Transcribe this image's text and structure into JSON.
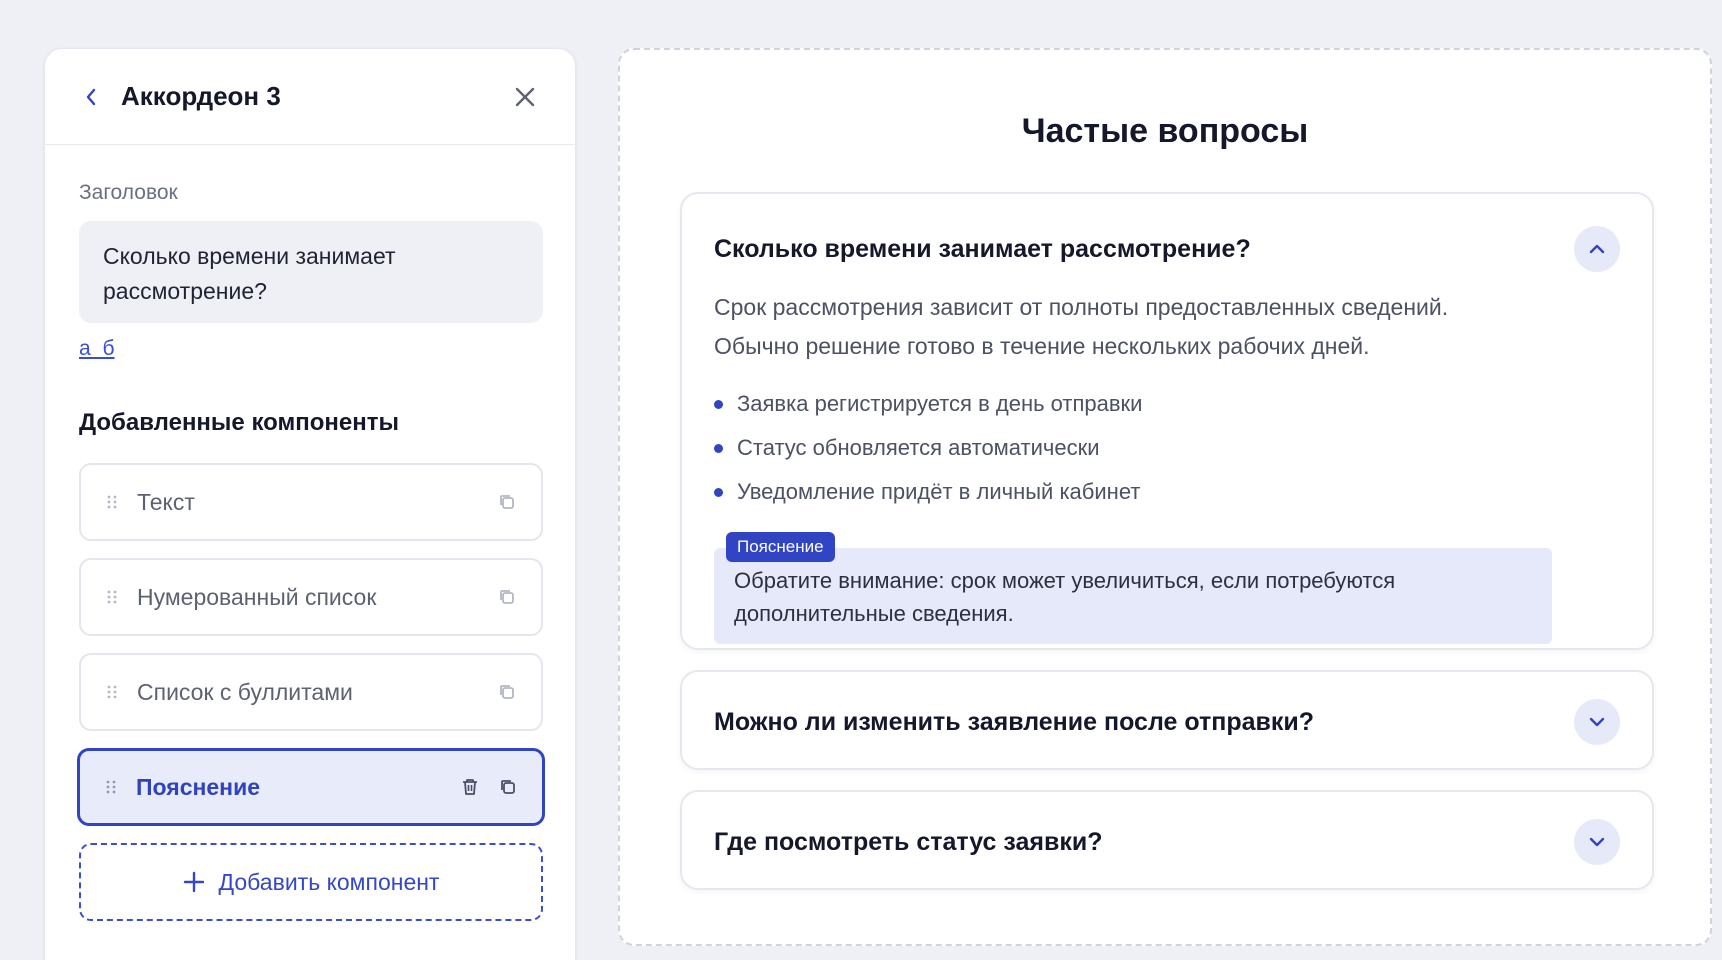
{
  "editor": {
    "title": "Аккордеон 3",
    "heading_label": "Заголовок",
    "heading_value": "Сколько времени занимает рассмотрение?",
    "format_link": "а б",
    "components_heading": "Добавленные компоненты",
    "components": [
      {
        "label": "Текст",
        "active": false
      },
      {
        "label": "Нумерованный список",
        "active": false
      },
      {
        "label": "Список с буллитами",
        "active": false
      },
      {
        "label": "Пояснение",
        "active": true
      }
    ],
    "add_button": "Добавить компонент"
  },
  "preview": {
    "title": "Частые вопросы",
    "items": [
      {
        "question": "Сколько времени занимает рассмотрение?",
        "expanded": true,
        "answer_lines": [
          "Срок рассмотрения зависит от полноты предоставленных сведений.",
          "Обычно решение готово в течение нескольких рабочих дней."
        ],
        "bullets": [
          "Заявка регистрируется в день отправки",
          "Статус обновляется автоматически",
          "Уведомление придёт в личный кабинет"
        ],
        "note_tag": "Пояснение",
        "note_text": "Обратите внимание: срок может увеличиться, если потребуются дополнительные сведения."
      },
      {
        "question": "Можно ли изменить заявление после отправки?",
        "expanded": false
      },
      {
        "question": "Где посмотреть статус заявки?",
        "expanded": false
      }
    ]
  },
  "colors": {
    "accent": "#3144c4",
    "background": "#eef0f5",
    "note_bg": "#e6e9fa",
    "chevron_bg": "#e6e9f7"
  },
  "icons": {
    "back": "chevron-left-icon",
    "close": "close-icon",
    "drag": "drag-handle-icon",
    "copy": "copy-icon",
    "delete": "trash-icon",
    "add": "plus-icon",
    "collapse": "chevron-up-icon",
    "expand": "chevron-down-icon"
  }
}
